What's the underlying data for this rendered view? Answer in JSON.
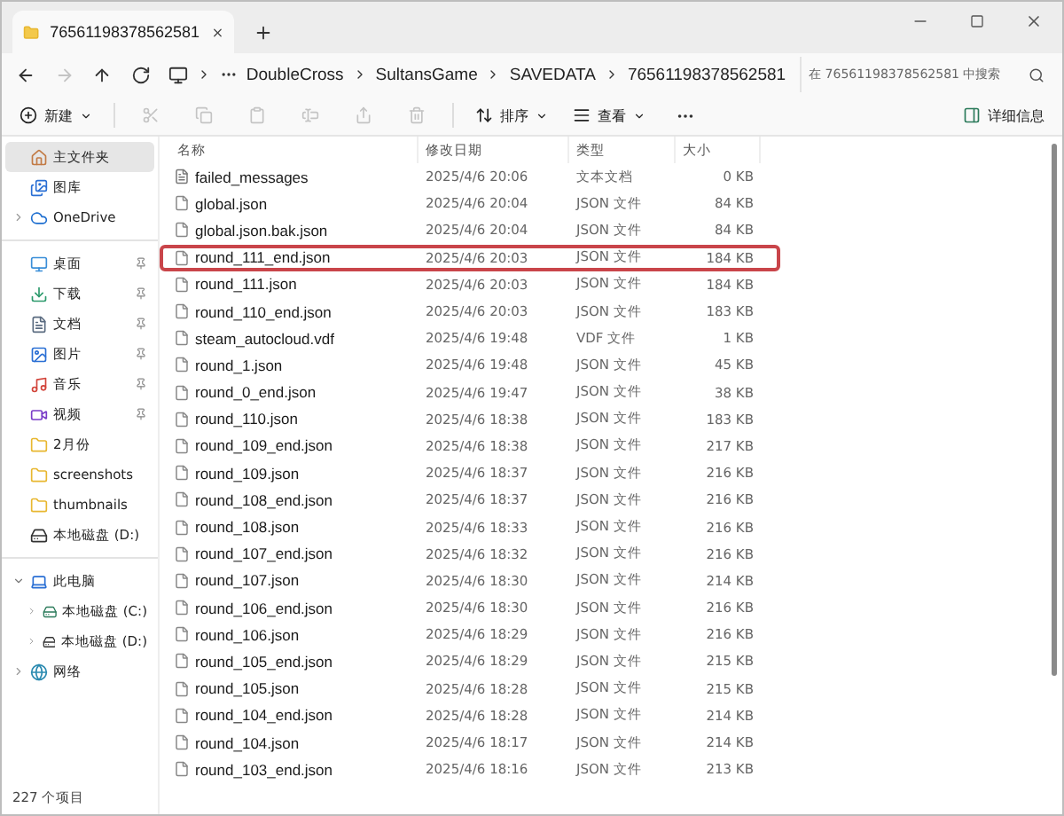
{
  "tab": {
    "title": "76561198378562581"
  },
  "nav": [
    {
      "kind": "back",
      "disabled": false
    },
    {
      "kind": "forward",
      "disabled": true
    },
    {
      "kind": "up",
      "disabled": false
    },
    {
      "kind": "refresh",
      "disabled": false
    }
  ],
  "breadcrumb": [
    "DoubleCross",
    "SultansGame",
    "SAVEDATA",
    "76561198378562581"
  ],
  "search": {
    "placeholder": "在 76561198378562581 中搜索"
  },
  "toolbar": {
    "new_label": "新建",
    "actions": [
      {
        "kind": "cut",
        "disabled": true
      },
      {
        "kind": "copy",
        "disabled": true
      },
      {
        "kind": "paste",
        "disabled": true
      },
      {
        "kind": "rename",
        "disabled": true
      },
      {
        "kind": "share",
        "disabled": true
      },
      {
        "kind": "delete",
        "disabled": true
      }
    ],
    "sort_label": "排序",
    "view_label": "查看",
    "details_label": "详细信息"
  },
  "sidebar": {
    "groups": [
      [
        {
          "label": "主文件夹",
          "kind": "home",
          "selected": true,
          "pinned": false
        },
        {
          "label": "图库",
          "kind": "gallery",
          "selected": false,
          "pinned": false
        },
        {
          "label": "OneDrive",
          "kind": "cloud",
          "selected": false,
          "pinned": false,
          "expanded": false
        }
      ],
      [
        {
          "label": "桌面",
          "kind": "desktop",
          "selected": false,
          "pinned": true
        },
        {
          "label": "下载",
          "kind": "download",
          "selected": false,
          "pinned": true
        },
        {
          "label": "文档",
          "kind": "document",
          "selected": false,
          "pinned": true
        },
        {
          "label": "图片",
          "kind": "pictures",
          "selected": false,
          "pinned": true
        },
        {
          "label": "音乐",
          "kind": "music",
          "selected": false,
          "pinned": true
        },
        {
          "label": "视频",
          "kind": "video",
          "selected": false,
          "pinned": true
        },
        {
          "label": "2月份",
          "kind": "folder",
          "selected": false,
          "pinned": false
        },
        {
          "label": "screenshots",
          "kind": "folder",
          "selected": false,
          "pinned": false
        },
        {
          "label": "thumbnails",
          "kind": "folder",
          "selected": false,
          "pinned": false
        },
        {
          "label": "本地磁盘 (D:)",
          "kind": "drive",
          "selected": false,
          "pinned": false
        }
      ],
      [
        {
          "label": "此电脑",
          "kind": "pc",
          "selected": false,
          "pinned": false,
          "expanded": true,
          "children": [
            {
              "label": "本地磁盘 (C:)",
              "kind": "system-drive",
              "selected": false,
              "pinned": false,
              "expanded": false
            },
            {
              "label": "本地磁盘 (D:)",
              "kind": "drive",
              "selected": false,
              "pinned": false,
              "expanded": false
            }
          ]
        },
        {
          "label": "网络",
          "kind": "network",
          "selected": false,
          "pinned": false,
          "expanded": false
        }
      ]
    ]
  },
  "table": {
    "columns": [
      "名称",
      "修改日期",
      "类型",
      "大小"
    ],
    "rows": [
      {
        "kind": "text",
        "name": "failed_messages",
        "date": "2025/4/6 20:06",
        "type": "文本文档",
        "size": "0 KB",
        "highlighted": false
      },
      {
        "kind": "file",
        "name": "global.json",
        "date": "2025/4/6 20:04",
        "type": "JSON 文件",
        "size": "84 KB",
        "highlighted": false
      },
      {
        "kind": "file",
        "name": "global.json.bak.json",
        "date": "2025/4/6 20:04",
        "type": "JSON 文件",
        "size": "84 KB",
        "highlighted": false
      },
      {
        "kind": "file",
        "name": "round_111_end.json",
        "date": "2025/4/6 20:03",
        "type": "JSON 文件",
        "size": "184 KB",
        "highlighted": true
      },
      {
        "kind": "file",
        "name": "round_111.json",
        "date": "2025/4/6 20:03",
        "type": "JSON 文件",
        "size": "184 KB",
        "highlighted": false
      },
      {
        "kind": "file",
        "name": "round_110_end.json",
        "date": "2025/4/6 20:03",
        "type": "JSON 文件",
        "size": "183 KB",
        "highlighted": false
      },
      {
        "kind": "file",
        "name": "steam_autocloud.vdf",
        "date": "2025/4/6 19:48",
        "type": "VDF 文件",
        "size": "1 KB",
        "highlighted": false
      },
      {
        "kind": "file",
        "name": "round_1.json",
        "date": "2025/4/6 19:48",
        "type": "JSON 文件",
        "size": "45 KB",
        "highlighted": false
      },
      {
        "kind": "file",
        "name": "round_0_end.json",
        "date": "2025/4/6 19:47",
        "type": "JSON 文件",
        "size": "38 KB",
        "highlighted": false
      },
      {
        "kind": "file",
        "name": "round_110.json",
        "date": "2025/4/6 18:38",
        "type": "JSON 文件",
        "size": "183 KB",
        "highlighted": false
      },
      {
        "kind": "file",
        "name": "round_109_end.json",
        "date": "2025/4/6 18:38",
        "type": "JSON 文件",
        "size": "217 KB",
        "highlighted": false
      },
      {
        "kind": "file",
        "name": "round_109.json",
        "date": "2025/4/6 18:37",
        "type": "JSON 文件",
        "size": "216 KB",
        "highlighted": false
      },
      {
        "kind": "file",
        "name": "round_108_end.json",
        "date": "2025/4/6 18:37",
        "type": "JSON 文件",
        "size": "216 KB",
        "highlighted": false
      },
      {
        "kind": "file",
        "name": "round_108.json",
        "date": "2025/4/6 18:33",
        "type": "JSON 文件",
        "size": "216 KB",
        "highlighted": false
      },
      {
        "kind": "file",
        "name": "round_107_end.json",
        "date": "2025/4/6 18:32",
        "type": "JSON 文件",
        "size": "216 KB",
        "highlighted": false
      },
      {
        "kind": "file",
        "name": "round_107.json",
        "date": "2025/4/6 18:30",
        "type": "JSON 文件",
        "size": "214 KB",
        "highlighted": false
      },
      {
        "kind": "file",
        "name": "round_106_end.json",
        "date": "2025/4/6 18:30",
        "type": "JSON 文件",
        "size": "216 KB",
        "highlighted": false
      },
      {
        "kind": "file",
        "name": "round_106.json",
        "date": "2025/4/6 18:29",
        "type": "JSON 文件",
        "size": "216 KB",
        "highlighted": false
      },
      {
        "kind": "file",
        "name": "round_105_end.json",
        "date": "2025/4/6 18:29",
        "type": "JSON 文件",
        "size": "215 KB",
        "highlighted": false
      },
      {
        "kind": "file",
        "name": "round_105.json",
        "date": "2025/4/6 18:28",
        "type": "JSON 文件",
        "size": "215 KB",
        "highlighted": false
      },
      {
        "kind": "file",
        "name": "round_104_end.json",
        "date": "2025/4/6 18:28",
        "type": "JSON 文件",
        "size": "214 KB",
        "highlighted": false
      },
      {
        "kind": "file",
        "name": "round_104.json",
        "date": "2025/4/6 18:17",
        "type": "JSON 文件",
        "size": "214 KB",
        "highlighted": false
      },
      {
        "kind": "file",
        "name": "round_103_end.json",
        "date": "2025/4/6 18:16",
        "type": "JSON 文件",
        "size": "213 KB",
        "highlighted": false
      }
    ]
  },
  "status_bar": {
    "count": "227 个项目"
  }
}
